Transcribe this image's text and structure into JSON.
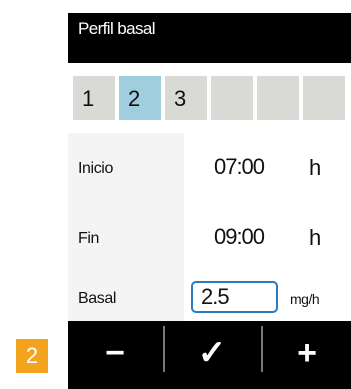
{
  "header": {
    "title": "Perfil basal"
  },
  "tabs": [
    {
      "label": "1",
      "selected": false
    },
    {
      "label": "2",
      "selected": true
    },
    {
      "label": "3",
      "selected": false
    },
    {
      "label": "",
      "selected": false
    },
    {
      "label": "",
      "selected": false
    }
  ],
  "fields": {
    "start": {
      "label": "Inicio",
      "value": "07:00",
      "unit": "h"
    },
    "end": {
      "label": "Fin",
      "value": "09:00",
      "unit": "h"
    },
    "basal": {
      "label": "Basal",
      "value": "2.5",
      "unit": "mg/h"
    }
  },
  "buttons": {
    "minus": "−",
    "confirm": "✓",
    "plus": "+"
  },
  "step_badge": "2",
  "colors": {
    "selected_tab": "#9fcfdf",
    "input_border": "#2a7bbf",
    "badge": "#f4a31e"
  }
}
